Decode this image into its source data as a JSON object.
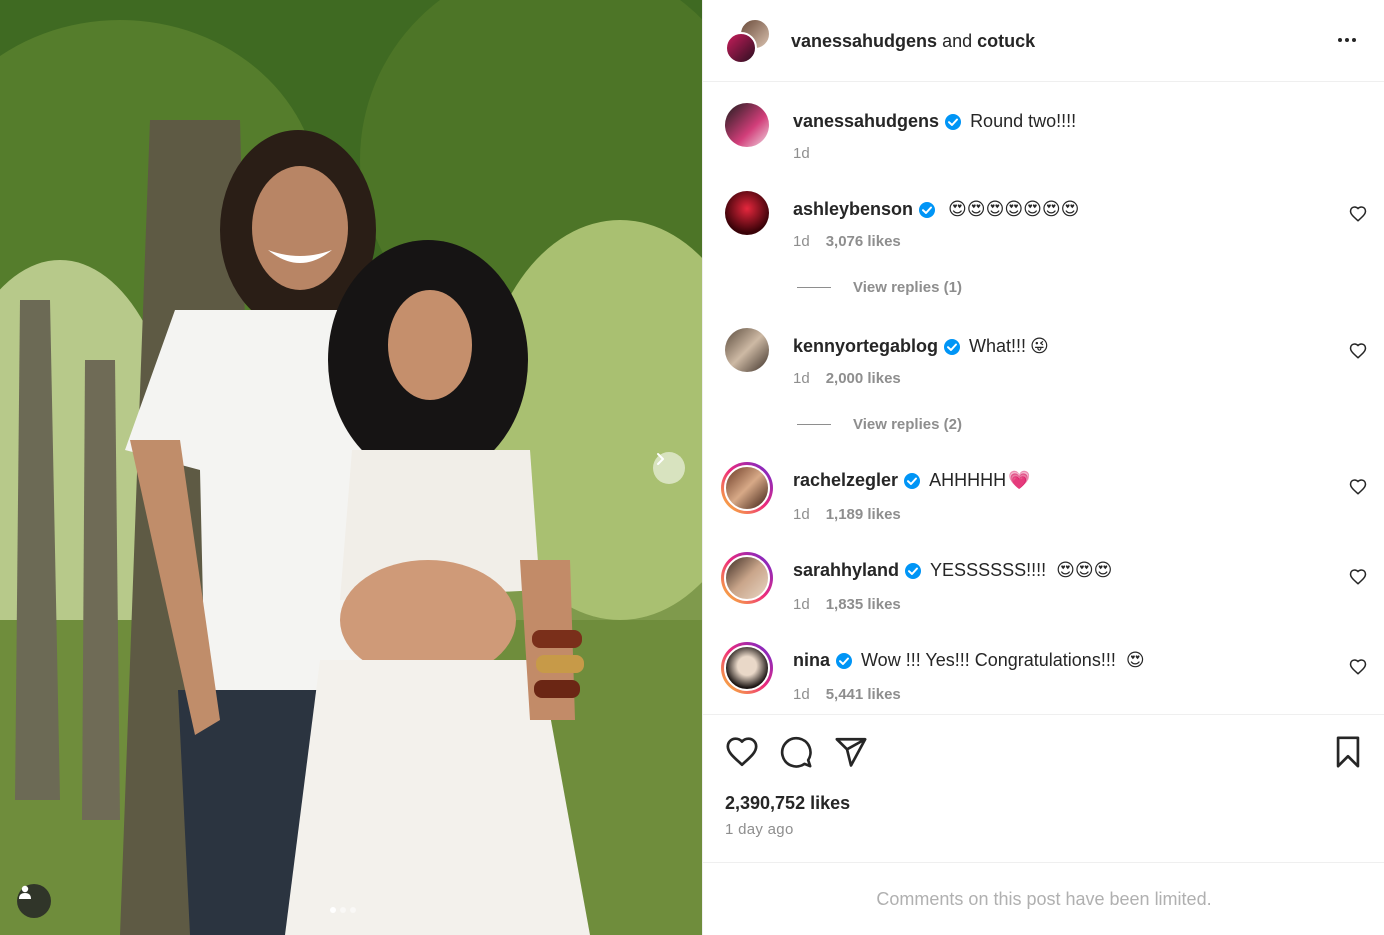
{
  "header": {
    "title_user": "vanessahudgens",
    "title_conj": " and ",
    "title_user2": "cotuck"
  },
  "caption": {
    "user": "vanessahudgens",
    "text": "Round two!!!!",
    "time": "1d"
  },
  "comments": [
    {
      "user": "ashleybenson",
      "text": "",
      "emoji": "😍😍😍😍😍😍😍",
      "time": "1d",
      "likes": "3,076 likes",
      "replies": "View replies (1)"
    },
    {
      "user": "kennyortegablog",
      "text": "What!!!",
      "emoji": "😜",
      "time": "1d",
      "likes": "2,000 likes",
      "replies": "View replies (2)"
    },
    {
      "user": "rachelzegler",
      "text": "AHHHHH",
      "emoji": "💗",
      "time": "1d",
      "likes": "1,189 likes"
    },
    {
      "user": "sarahhyland",
      "text": "YESSSSSS!!!!",
      "emoji": "😍😍😍",
      "time": "1d",
      "likes": "1,835 likes"
    },
    {
      "user": "nina",
      "text": "Wow !!! Yes!!! Congratulations!!!",
      "emoji": "😍",
      "time": "1d",
      "likes": "5,441 likes"
    }
  ],
  "footer": {
    "likes": "2,390,752 likes",
    "time_ago": "1 day ago",
    "limited_notice": "Comments on this post have been limited."
  },
  "icons": {
    "like": "heart-icon",
    "comment": "comment-bubble-icon",
    "share": "paper-plane-icon",
    "save": "bookmark-icon",
    "more": "more-horizontal-icon",
    "verified": "verified-badge-icon"
  },
  "colors": {
    "verified": "#0095f6",
    "text": "#262626",
    "secondary": "#8e8e8e"
  }
}
